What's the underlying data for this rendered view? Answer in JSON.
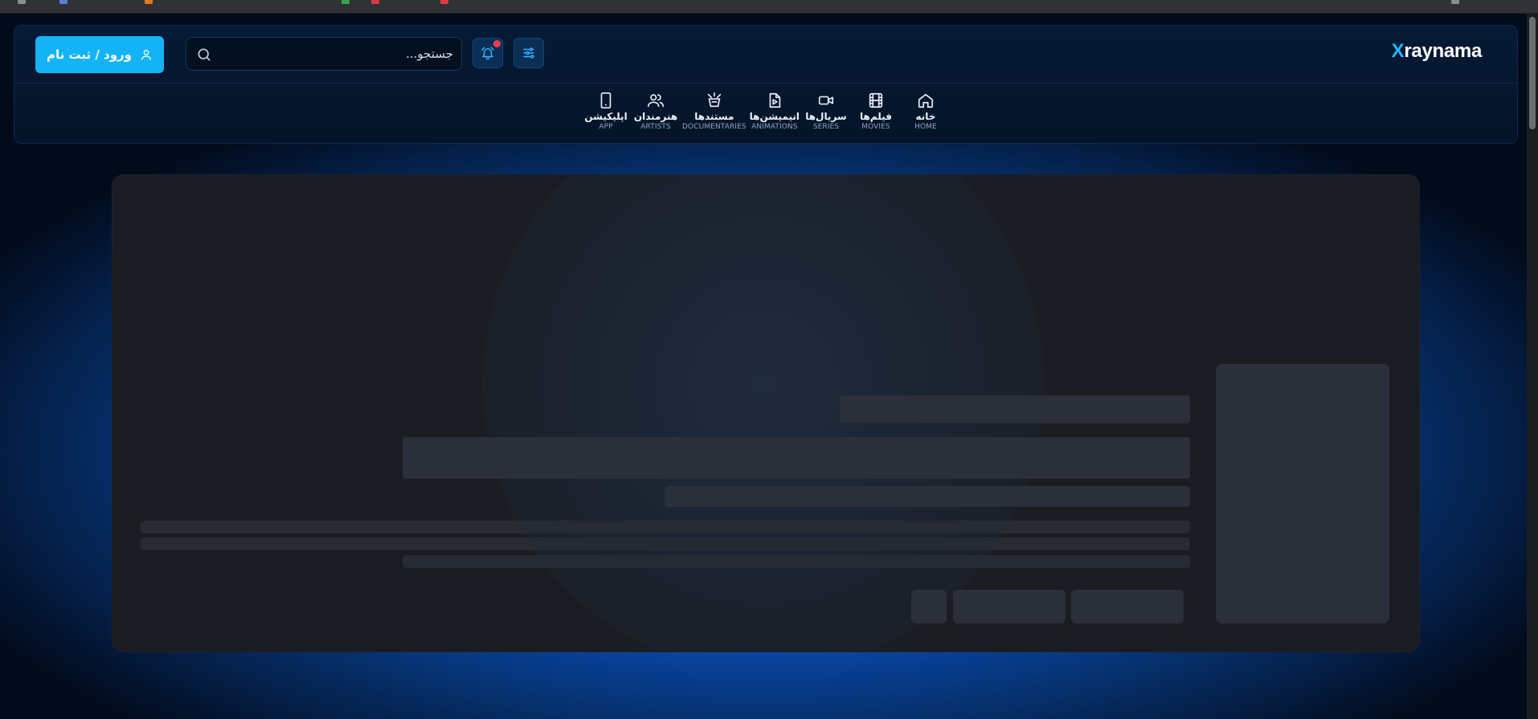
{
  "brand": {
    "logo_accent": "X",
    "logo_rest": "raynama",
    "accent_color": "#1fb6ff"
  },
  "header": {
    "login_label": "ورود / ثبت نام",
    "search": {
      "placeholder": "جستجو...",
      "value": ""
    },
    "notification_badge_color": "#ff3b4b"
  },
  "nav": {
    "items": [
      {
        "fa": "خانه",
        "en": "HOME",
        "icon": "home-icon"
      },
      {
        "fa": "فیلم‌ها",
        "en": "MOVIES",
        "icon": "film-icon"
      },
      {
        "fa": "سریال‌ها",
        "en": "SERIES",
        "icon": "video-icon"
      },
      {
        "fa": "انیمیشن‌ها",
        "en": "ANIMATIONS",
        "icon": "play-file-icon"
      },
      {
        "fa": "مستندها",
        "en": "DOCUMENTARIES",
        "icon": "camera-icon"
      },
      {
        "fa": "هنرمندان",
        "en": "ARTISTS",
        "icon": "users-icon"
      },
      {
        "fa": "اپلیکیشن",
        "en": "APP",
        "icon": "phone-icon"
      }
    ]
  },
  "hero": {
    "state": "loading-skeleton"
  }
}
